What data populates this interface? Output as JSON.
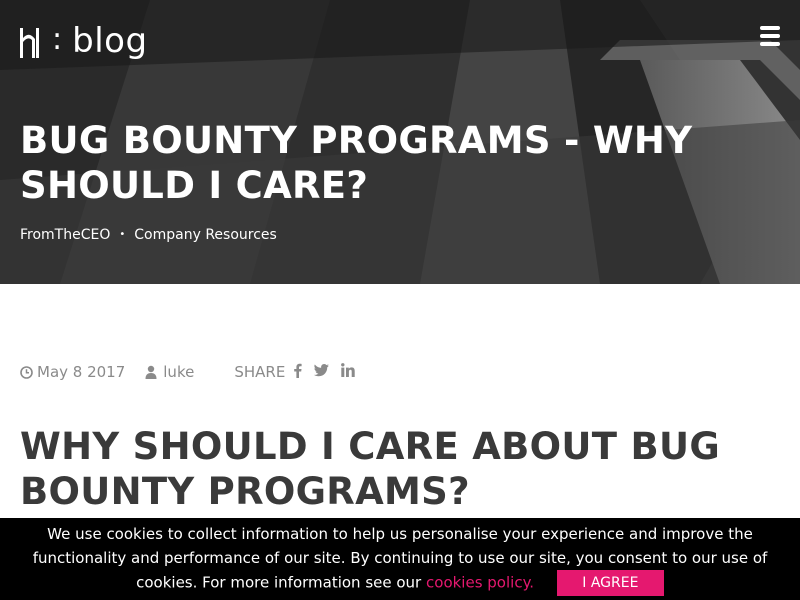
{
  "header": {
    "logo_text": "blog",
    "logo_alt": "h1 : blog"
  },
  "hero": {
    "title": "BUG BOUNTY PROGRAMS - WHY SHOULD I CARE?",
    "tags": [
      {
        "label": "FromTheCEO"
      },
      {
        "label": "Company Resources"
      }
    ],
    "tag_separator": "•"
  },
  "meta": {
    "date": "May 8 2017",
    "author": "luke",
    "share_label": "SHARE",
    "share_icons": [
      "facebook-icon",
      "twitter-icon",
      "linkedin-icon"
    ]
  },
  "article": {
    "heading": "WHY SHOULD I CARE ABOUT BUG BOUNTY PROGRAMS?"
  },
  "cookie": {
    "message": "We use cookies to collect information to help us personalise your experience and improve the functionality and performance of our site. By continuing to use our site, you consent to our use of cookies. For more information see our",
    "link_text": "cookies policy.",
    "button_label": "I AGREE"
  },
  "colors": {
    "accent": "#e5186f",
    "heading": "#3a3a3a",
    "meta": "#8a8a8a",
    "cookie_bg": "#000000"
  }
}
